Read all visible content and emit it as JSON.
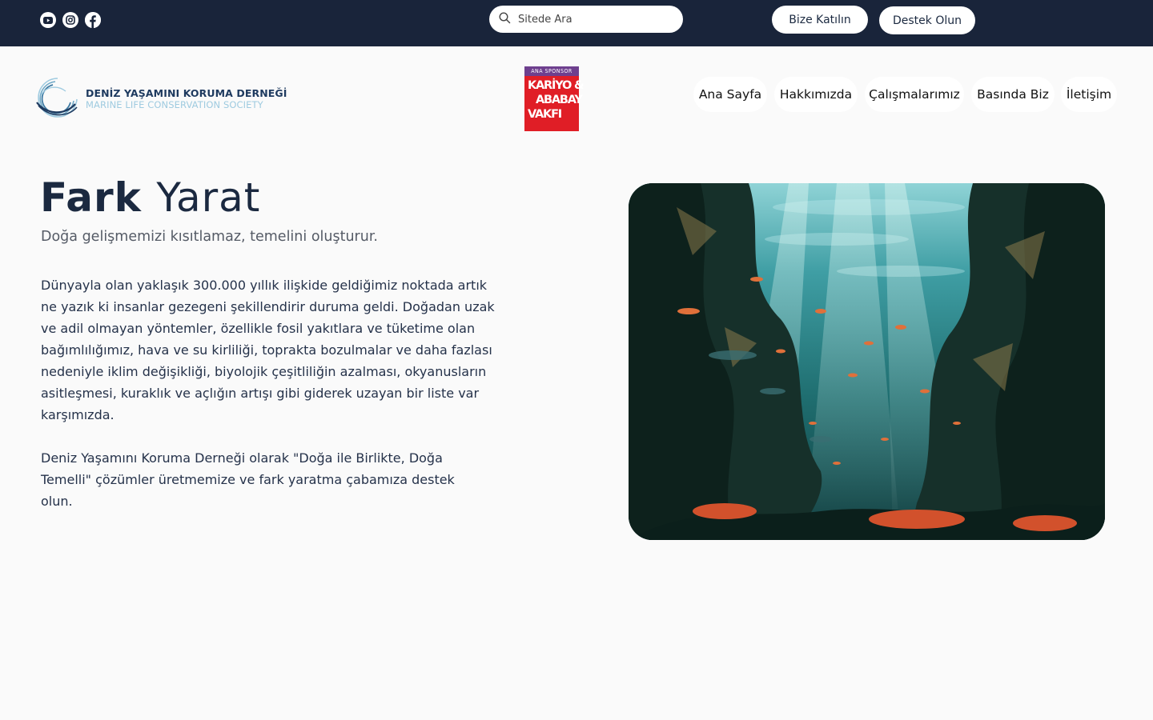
{
  "topbar": {
    "social": [
      {
        "name": "youtube-icon"
      },
      {
        "name": "instagram-icon"
      },
      {
        "name": "facebook-icon"
      }
    ],
    "search_placeholder": "Sitede Ara",
    "join_label": "Bize Katılın",
    "support_label": "Destek Olun"
  },
  "header": {
    "logo_name_tr": "DENİZ YAŞAMINI KORUMA DERNEĞİ",
    "logo_name_en": "MARINE LIFE CONSERVATION SOCIETY",
    "sponsor_tag": "ANA SPONSOR",
    "sponsor_line1": "KARİYO &",
    "sponsor_line2": "ABABAY",
    "sponsor_line3": "VAKFI",
    "nav": [
      {
        "label": "Ana Sayfa"
      },
      {
        "label": "Hakkımızda"
      },
      {
        "label": "Çalışmalarımız"
      },
      {
        "label": "Basında Biz"
      },
      {
        "label": "İletişim"
      }
    ]
  },
  "main": {
    "title_bold": "Fark",
    "title_light": "Yarat",
    "subtitle": "Doğa gelişmemizi kısıtlamaz, temelini oluşturur.",
    "paragraph1": "Dünyayla olan yaklaşık 300.000 yıllık ilişkide geldiğimiz noktada artık ne yazık ki insanlar gezegeni şekillendirir duruma geldi. Doğadan uzak ve adil olmayan yöntemler, özellikle fosil yakıtlara ve tüketime olan bağımlılığımız, hava ve su kirliliği, toprakta bozulmalar ve daha fazlası nedeniyle iklim değişikliği, biyolojik çeşitliliğin azalması, okyanusların asitleşmesi, kuraklık ve açlığın artışı gibi giderek uzayan bir liste var karşımızda.",
    "paragraph2": "Deniz Yaşamını Koruma Derneği olarak \"Doğa ile Birlikte, Doğa Temelli\" çözümler üretmemize ve fark yaratma çabamıza destek olun."
  },
  "colors": {
    "topbar": "#19243a",
    "text_dark": "#1b2940",
    "logo_light": "#9fcbe0",
    "sponsor_red": "#e01e26",
    "sponsor_purple": "#6e3f8e"
  }
}
